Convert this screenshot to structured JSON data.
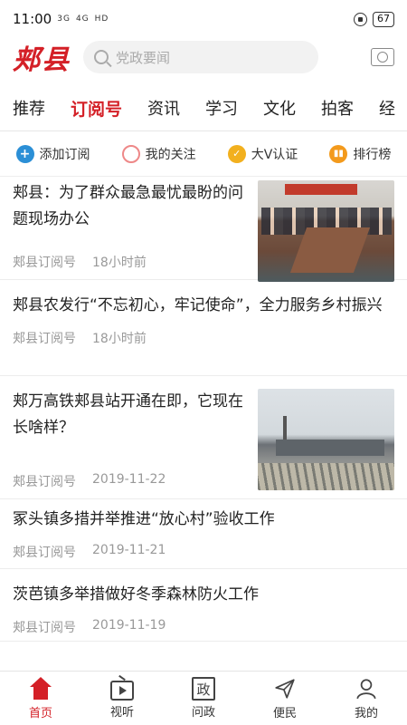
{
  "status_bar": {
    "time": "11:00",
    "signal_1": "3G",
    "signal_2": "4G",
    "hd": "HD",
    "battery": "67"
  },
  "header": {
    "brand": "郏县",
    "search_placeholder": "党政要闻"
  },
  "tabs": [
    {
      "label": "推荐",
      "active": false
    },
    {
      "label": "订阅号",
      "active": true
    },
    {
      "label": "资讯",
      "active": false
    },
    {
      "label": "学习",
      "active": false
    },
    {
      "label": "文化",
      "active": false
    },
    {
      "label": "拍客",
      "active": false
    },
    {
      "label": "经",
      "active": false
    }
  ],
  "quick_actions": [
    {
      "label": "添加订阅",
      "icon": "plus-icon",
      "color": "#2b8fd6"
    },
    {
      "label": "我的关注",
      "icon": "circle-icon",
      "color": "#e88888"
    },
    {
      "label": "大V认证",
      "icon": "v-badge-icon",
      "color": "#f2b01e"
    },
    {
      "label": "排行榜",
      "icon": "ranking-icon",
      "color": "#f39a1c"
    }
  ],
  "articles": [
    {
      "title": "郏县：为了群众最急最忧最盼的问题现场办公",
      "source": "郏县订阅号",
      "time": "18小时前",
      "has_image": true
    },
    {
      "title": "郏县农发行“不忘初心，牢记使命”，全力服务乡村振兴",
      "source": "郏县订阅号",
      "time": "18小时前",
      "has_image": false
    },
    {
      "title": "郏万高铁郏县站开通在即，它现在长啥样？",
      "source": "郏县订阅号",
      "time": "2019-11-22",
      "has_image": true
    },
    {
      "title": "冢头镇多措并举推进“放心村”验收工作",
      "source": "郏县订阅号",
      "time": "2019-11-21",
      "has_image": false
    },
    {
      "title": "茨芭镇多举措做好冬季森林防火工作",
      "source": "郏县订阅号",
      "time": "2019-11-19",
      "has_image": false
    }
  ],
  "bottom_nav": [
    {
      "label": "首页",
      "icon": "home-icon",
      "active": true
    },
    {
      "label": "视听",
      "icon": "tv-icon",
      "active": false
    },
    {
      "label": "问政",
      "icon": "zheng-icon",
      "icon_text": "政",
      "active": false
    },
    {
      "label": "便民",
      "icon": "send-icon",
      "active": false
    },
    {
      "label": "我的",
      "icon": "user-icon",
      "active": false
    }
  ],
  "colors": {
    "accent": "#d42027",
    "muted_text": "#999999"
  }
}
